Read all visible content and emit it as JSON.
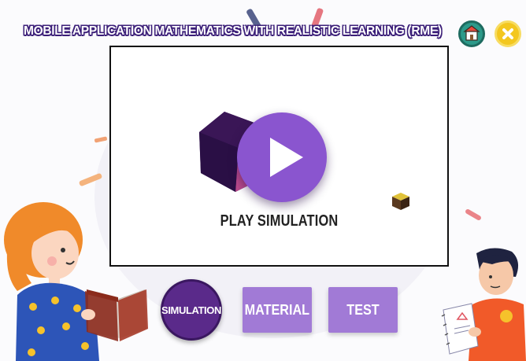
{
  "header": {
    "title": "MOBILE APPLICATION MATHEMATICS WITH REALISTIC LEARNING (RME)"
  },
  "video": {
    "label": "PLAY SIMULATION"
  },
  "nav": {
    "simulation": "SIMULATION",
    "material": "MATERIAL",
    "test": "TEST"
  },
  "icons": {
    "home": "home-icon",
    "close": "close-icon",
    "play": "play-icon"
  },
  "colors": {
    "title_outline": "#3b1e78",
    "home_button": "#2c9a8a",
    "close_button": "#f3c71f",
    "play_button": "#8a55cf",
    "nav_active": "#5a2a8a",
    "nav_inactive": "#a17ad6"
  }
}
